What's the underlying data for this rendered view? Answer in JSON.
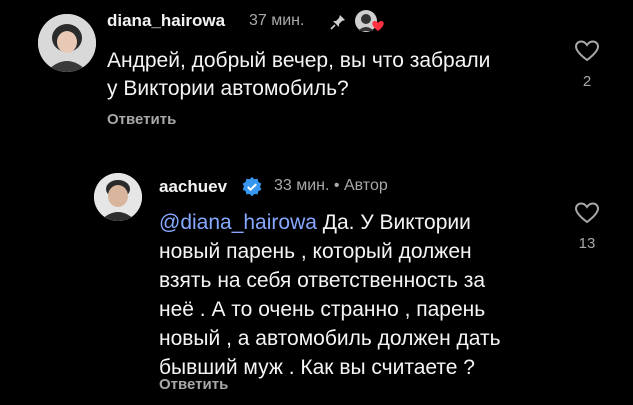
{
  "comments": [
    {
      "username": "diana_hairowa",
      "time": "37 мин.",
      "text_lines": [
        "Андрей, добрый вечер, вы что забрали",
        "у Виктории автомобиль?"
      ],
      "reply_label": "Ответить",
      "like_count": "2",
      "pinned_icon": "pin-icon",
      "liked_by_author_icon": "author-heart-avatar"
    },
    {
      "username": "aachuev",
      "time": "33 мин.",
      "author_badge": "Автор",
      "mention": "@diana_hairowa",
      "text_first": " Да. У Виктории",
      "text_lines": [
        "новый парень , который должен",
        "взять на себя ответственность за",
        "неё . А то очень странно , парень",
        "новый , а автомобиль должен дать",
        "бывший муж . Как вы считаете ?"
      ],
      "reply_label": "Ответить",
      "like_count": "13",
      "verified_icon": "verified-badge-icon"
    }
  ],
  "colors": {
    "background": "#000000",
    "text": "#f5f5f5",
    "muted": "#a8a8a8",
    "mention": "#86a9ff",
    "verified": "#3797f0"
  }
}
